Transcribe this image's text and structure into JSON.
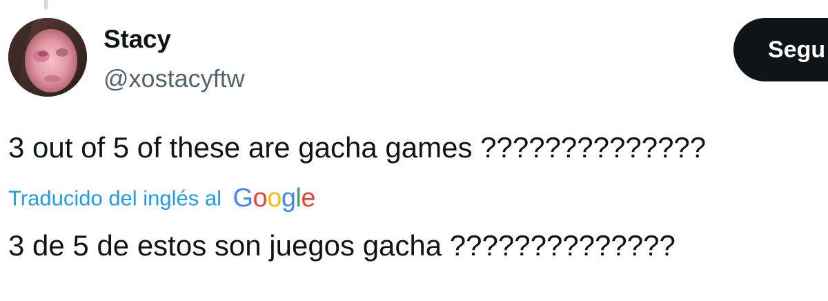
{
  "author": {
    "display_name": "Stacy",
    "handle": "@xostacyftw"
  },
  "follow_button": {
    "label": "Segu"
  },
  "tweet": {
    "text": "3 out of 5 of these are gacha games ??????????????"
  },
  "translation": {
    "label": "Traducido del inglés al",
    "provider_letters": [
      "G",
      "o",
      "o",
      "g",
      "l",
      "e"
    ],
    "provider_colors": [
      "#4285f4",
      "#ea4335",
      "#fbbc05",
      "#4285f4",
      "#34a853",
      "#ea4335"
    ],
    "text": "3 de 5 de estos son juegos gacha ??????????????"
  },
  "colors": {
    "text_primary": "#0f1419",
    "text_secondary": "#536471",
    "link": "#1d9bf0",
    "button_bg": "#0f1419"
  }
}
